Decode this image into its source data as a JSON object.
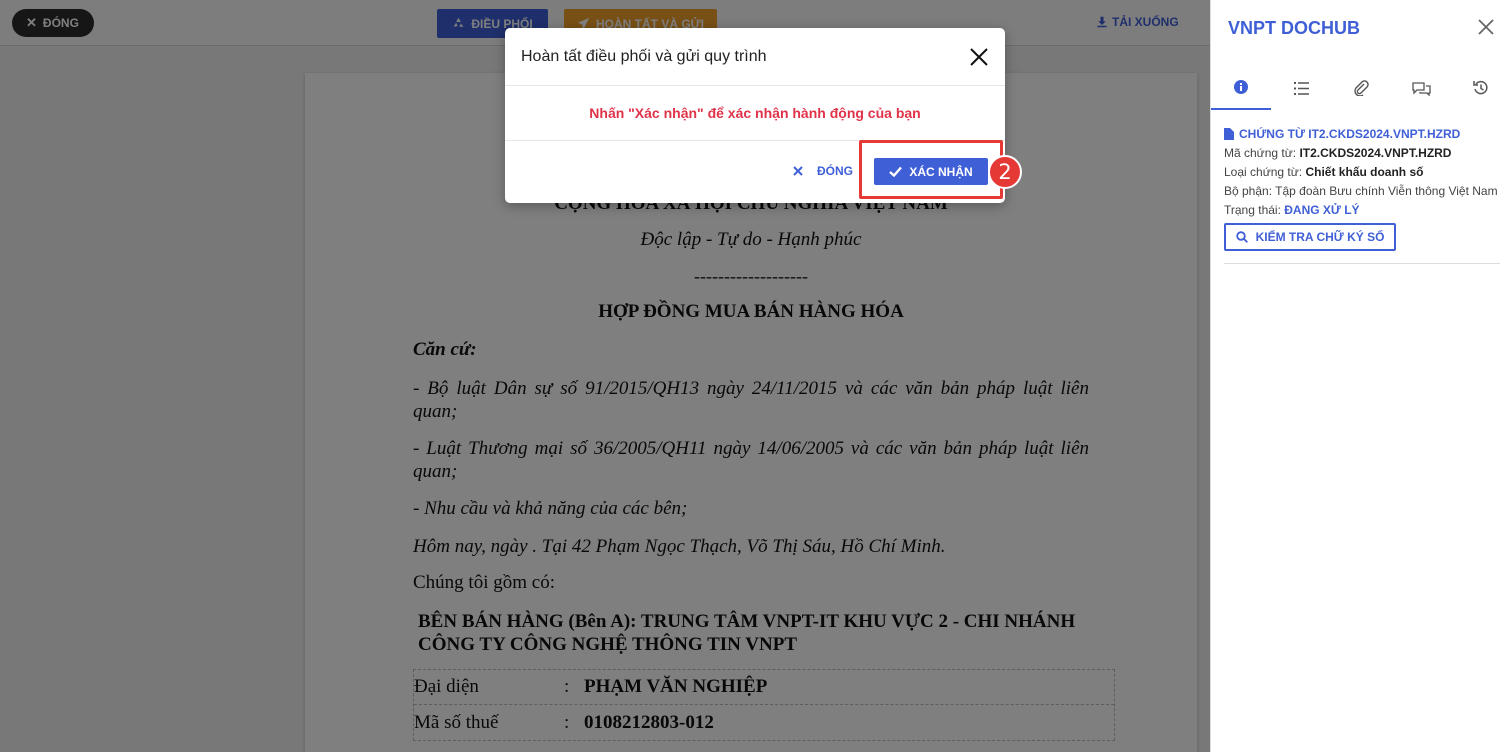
{
  "toolbar": {
    "close_label": "ĐÓNG",
    "dispatch_label": "ĐIỀU PHỐI",
    "finish_label": "HOÀN TẤT VÀ GỬI",
    "download_label": "TẢI XUỐNG"
  },
  "document": {
    "nation": "CỘNG HÒA XÃ HỘI CHỦ NGHĨA VIỆT NAM",
    "motto": "Độc lập - Tự do - Hạnh phúc",
    "separator": "-------------------",
    "title": "HỢP ĐỒNG MUA BÁN HÀNG HÓA",
    "basis_heading": "Căn cứ:",
    "basis_items": [
      "- Bộ luật Dân sự số 91/2015/QH13 ngày 24/11/2015 và các văn bản pháp luật liên quan;",
      "- Luật Thương mại số 36/2005/QH11 ngày 14/06/2005 và các văn bản pháp luật liên quan;",
      "- Nhu cầu và khả năng của các bên;"
    ],
    "date_place": "Hôm nay, ngày . Tại 42 Phạm Ngọc Thạch, Võ Thị Sáu, Hồ Chí Minh.",
    "we_include": "Chúng tôi gồm có:",
    "seller": "BÊN BÁN HÀNG (Bên A): TRUNG TÂM VNPT-IT KHU VỰC 2 - CHI NHÁNH CÔNG TY CÔNG NGHỆ THÔNG TIN VNPT",
    "rep_rows": [
      {
        "label": "Đại diện",
        "colon": ":",
        "value": "PHẠM VĂN NGHIỆP"
      },
      {
        "label": "Mã số thuế",
        "colon": ":",
        "value": "0108212803-012"
      }
    ]
  },
  "modal": {
    "title": "Hoàn tất điều phối và gửi quy trình",
    "message": "Nhấn \"Xác nhận\" để xác nhận hành động của bạn",
    "cancel_label": "ĐÓNG",
    "confirm_label": "XÁC NHẬN",
    "step_number": "2"
  },
  "sidebar": {
    "title": "VNPT DOCHUB",
    "tabs": [
      "info-icon",
      "list-icon",
      "attachment-icon",
      "comments-icon",
      "history-icon"
    ],
    "doc_link": "CHỨNG TỪ IT2.CKDS2024.VNPT.HZRD",
    "code_label": "Mã chứng từ: ",
    "code_value": "IT2.CKDS2024.VNPT.HZRD",
    "type_label": "Loại chứng từ: ",
    "type_value": "Chiết khấu doanh số",
    "dept_label": "Bộ phận: ",
    "dept_value": "Tập đoàn Bưu chính Viễn thông Việt Nam",
    "status_label": "Trạng thái: ",
    "status_value": "ĐANG XỬ LÝ",
    "verify_label": "KIỂM TRA CHỮ KÝ SỐ"
  },
  "colors": {
    "primary": "#3f5fd6",
    "warning": "#f0a12a",
    "danger": "#e53935",
    "message": "#e0334a"
  }
}
